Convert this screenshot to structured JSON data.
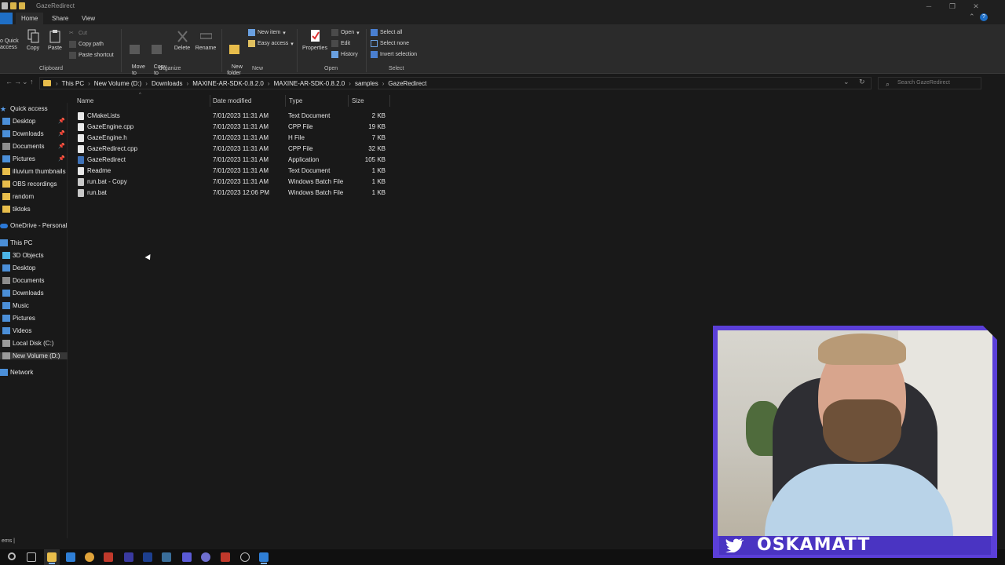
{
  "window": {
    "title": "GazeRedirect",
    "controls": {
      "minimize": "─",
      "restore": "❐",
      "close": "✕"
    }
  },
  "ribbon_tabs": {
    "file": "",
    "home": "Home",
    "share": "Share",
    "view": "View",
    "collapse": "⌃",
    "help": "?"
  },
  "ribbon": {
    "clipboard": {
      "label": "Clipboard",
      "pin": "o Quick\naccess",
      "copy": "Copy",
      "paste": "Paste",
      "cut": "Cut",
      "copy_path": "Copy path",
      "paste_shortcut": "Paste shortcut"
    },
    "organize": {
      "label": "Organize",
      "move_to": "Move\nto",
      "copy_to": "Copy\nto",
      "delete": "Delete",
      "rename": "Rename"
    },
    "new": {
      "label": "New",
      "new_folder": "New\nfolder",
      "new_item": "New item",
      "easy_access": "Easy access"
    },
    "open": {
      "label": "Open",
      "properties": "Properties",
      "open": "Open",
      "edit": "Edit",
      "history": "History"
    },
    "select": {
      "label": "Select",
      "select_all": "Select all",
      "select_none": "Select none",
      "invert_selection": "Invert selection"
    }
  },
  "address": {
    "back": "←",
    "forward": "→",
    "recent": "⌄",
    "up": "↑",
    "breadcrumb": [
      "This PC",
      "New Volume (D:)",
      "Downloads",
      "MAXINE-AR-SDK-0.8.2.0",
      "MAXINE-AR-SDK-0.8.2.0",
      "samples",
      "GazeRedirect"
    ],
    "separator": "›",
    "dropdown": "⌄",
    "refresh": "↻",
    "search_placeholder": "Search GazeRedirect",
    "search_icon": "⌕"
  },
  "navpane": {
    "quick_access": "Quick access",
    "quick_items": [
      {
        "label": "Desktop",
        "pinned": true,
        "icon": "desktop-icon"
      },
      {
        "label": "Downloads",
        "pinned": true,
        "icon": "downloads-icon"
      },
      {
        "label": "Documents",
        "pinned": true,
        "icon": "documents-icon"
      },
      {
        "label": "Pictures",
        "pinned": true,
        "icon": "pictures-icon"
      },
      {
        "label": "illuvium thumbnails",
        "pinned": false,
        "icon": "folder-icon"
      },
      {
        "label": "OBS recordings",
        "pinned": false,
        "icon": "folder-icon"
      },
      {
        "label": "random",
        "pinned": false,
        "icon": "folder-icon"
      },
      {
        "label": "tiktoks",
        "pinned": false,
        "icon": "folder-icon"
      }
    ],
    "pin_glyph": "📌",
    "onedrive": "OneDrive - Personal",
    "this_pc": "This PC",
    "pc_items": [
      {
        "label": "3D Objects",
        "icon": "3d-objects-icon"
      },
      {
        "label": "Desktop",
        "icon": "desktop-icon"
      },
      {
        "label": "Documents",
        "icon": "documents-icon"
      },
      {
        "label": "Downloads",
        "icon": "downloads-icon"
      },
      {
        "label": "Music",
        "icon": "music-icon"
      },
      {
        "label": "Pictures",
        "icon": "pictures-icon"
      },
      {
        "label": "Videos",
        "icon": "videos-icon"
      },
      {
        "label": "Local Disk (C:)",
        "icon": "drive-icon"
      },
      {
        "label": "New Volume (D:)",
        "icon": "drive-icon",
        "selected": true
      }
    ],
    "network": "Network"
  },
  "columns": {
    "name": "Name",
    "date": "Date modified",
    "type": "Type",
    "size": "Size",
    "sort_glyph": "^"
  },
  "files": [
    {
      "name": "CMakeLists",
      "date": "7/01/2023 11:31 AM",
      "type": "Text Document",
      "size": "2 KB",
      "kind": "doc"
    },
    {
      "name": "GazeEngine.cpp",
      "date": "7/01/2023 11:31 AM",
      "type": "CPP File",
      "size": "19 KB",
      "kind": "doc"
    },
    {
      "name": "GazeEngine.h",
      "date": "7/01/2023 11:31 AM",
      "type": "H File",
      "size": "7 KB",
      "kind": "doc"
    },
    {
      "name": "GazeRedirect.cpp",
      "date": "7/01/2023 11:31 AM",
      "type": "CPP File",
      "size": "32 KB",
      "kind": "doc"
    },
    {
      "name": "GazeRedirect",
      "date": "7/01/2023 11:31 AM",
      "type": "Application",
      "size": "105 KB",
      "kind": "app"
    },
    {
      "name": "Readme",
      "date": "7/01/2023 11:31 AM",
      "type": "Text Document",
      "size": "1 KB",
      "kind": "doc"
    },
    {
      "name": "run.bat - Copy",
      "date": "7/01/2023 11:31 AM",
      "type": "Windows Batch File",
      "size": "1 KB",
      "kind": "bat"
    },
    {
      "name": "run.bat",
      "date": "7/01/2023 12:06 PM",
      "type": "Windows Batch File",
      "size": "1 KB",
      "kind": "bat"
    }
  ],
  "status": {
    "text": "ems  |"
  },
  "webcam": {
    "handle": "OSKAMATT",
    "platform_icon": "twitter-bird-icon"
  },
  "colors": {
    "accent": "#1f6fc6",
    "webcam_border": "#5b3fd8",
    "folder": "#e8bd4b"
  }
}
